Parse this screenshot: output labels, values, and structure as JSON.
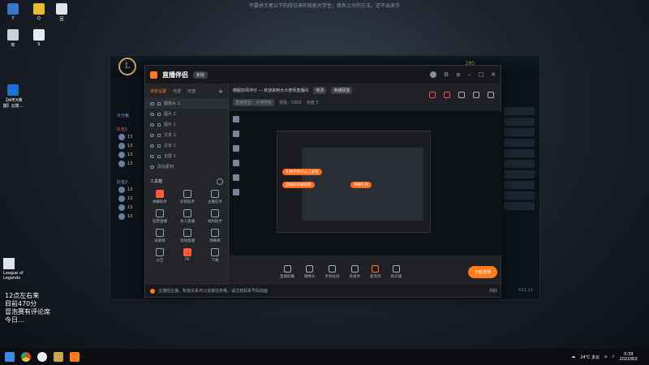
{
  "desktop": {
    "caption": "不要拼王者以下的段位来的技能大学生，我有上分的方法，还不出来学",
    "icons": [
      {
        "label": "Y"
      },
      {
        "label": "Q"
      },
      {
        "label": "回"
      },
      {
        "label": "软"
      },
      {
        "label": "S"
      },
      {
        "label": "【APEX英雄】云账..."
      }
    ],
    "league_label": "League of Legends",
    "overlay_lines": [
      "12点左右来",
      "目前470分",
      "冒泡赛有评论席",
      "今日..."
    ]
  },
  "lol": {
    "logo": "L",
    "currency": "280",
    "section_1": "队伍1",
    "section_2": "队伍2",
    "left_tab": "计分板",
    "row_values": [
      "13",
      "13",
      "13",
      "13",
      "13",
      "13",
      "13",
      "13"
    ],
    "version": "V11.11"
  },
  "app": {
    "brand": "直播伴侣",
    "version_badge": "新版",
    "panel_tabs": [
      "场景设置",
      "可选",
      "可选"
    ],
    "scenes": [
      {
        "name": "摄像头 1"
      },
      {
        "name": "图片 2"
      },
      {
        "name": "图片 1"
      },
      {
        "name": "文本 2"
      },
      {
        "name": "文本 1"
      },
      {
        "name": "全屏 1"
      },
      {
        "name": "添加素材"
      }
    ],
    "tools_title": "工具箱",
    "tools": [
      {
        "label": "弹幕助手"
      },
      {
        "label": "房管助手"
      },
      {
        "label": "主播任务"
      },
      {
        "label": "投票直播"
      },
      {
        "label": "多人直播"
      },
      {
        "label": "福利助手"
      },
      {
        "label": "贡献榜"
      },
      {
        "label": "连线直播"
      },
      {
        "label": "弹幕库"
      },
      {
        "label": "公告"
      },
      {
        "label": "PK"
      },
      {
        "label": "下载"
      }
    ],
    "stream_title": "韩服宗师冲分 — 欢迎来到大众老师直播间",
    "title_tag": "修改",
    "category": "英雄联盟",
    "sub_info_1": "直播类型：大神陪练",
    "sub_info_2": "观看：5903",
    "sub_info_3": "热度 3",
    "preview_pills": [
      "礼物点赞可以上屏哦",
      "直播间开播提醒",
      "弹幕礼物"
    ],
    "bottom_buttons": [
      {
        "label": "直播屏幕"
      },
      {
        "label": "摄像头"
      },
      {
        "label": "手机投屏"
      },
      {
        "label": "多媒体"
      },
      {
        "label": "麦克风"
      },
      {
        "label": "扬声器"
      }
    ],
    "start_button": "开始直播",
    "notice": "主播招主播，知道关系可以去做任务哦，请注意联系号码前面",
    "notice_right": "你好"
  },
  "taskbar": {
    "weather": "24°C 多云",
    "time": "0:39",
    "date": "2022/8/2"
  }
}
